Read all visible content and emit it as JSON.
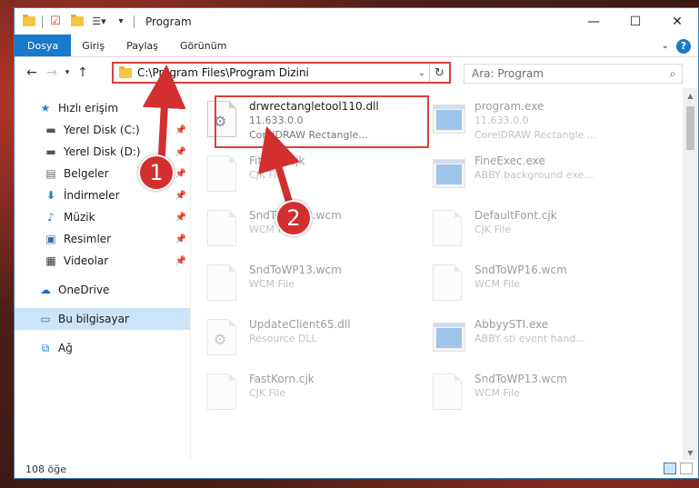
{
  "window": {
    "title": "Program"
  },
  "ribbon": {
    "tabs": [
      "Dosya",
      "Giriş",
      "Paylaş",
      "Görünüm"
    ]
  },
  "address": {
    "path": "C:\\Program Files\\Program Dizini"
  },
  "search": {
    "placeholder": "Ara: Program"
  },
  "nav": {
    "items": [
      {
        "label": "Hızlı erişim",
        "icon": "star-icon"
      },
      {
        "label": "Yerel Disk (C:)",
        "icon": "drive-icon"
      },
      {
        "label": "Yerel Disk (D:)",
        "icon": "drive-icon"
      },
      {
        "label": "Belgeler",
        "icon": "document-icon"
      },
      {
        "label": "İndirmeler",
        "icon": "download-icon"
      },
      {
        "label": "Müzik",
        "icon": "music-icon"
      },
      {
        "label": "Resimler",
        "icon": "pictures-icon"
      },
      {
        "label": "Videolar",
        "icon": "video-icon"
      },
      {
        "label": "OneDrive",
        "icon": "cloud-icon"
      },
      {
        "label": "Bu bilgisayar",
        "icon": "computer-icon"
      },
      {
        "label": "Ağ",
        "icon": "network-icon"
      }
    ]
  },
  "files": [
    {
      "name": "drwrectangletool110.dll",
      "line2": "11.633.0.0",
      "line3": "CorelDRAW Rectangle...",
      "icon": "dll-icon"
    },
    {
      "name": "program.exe",
      "line2": "11.633.0.0",
      "line3": "CorelDRAW Rectangle ...",
      "icon": "exe-icon"
    },
    {
      "name": "Fitman.cjk",
      "line2": "CJK File",
      "line3": "",
      "icon": "file-icon"
    },
    {
      "name": "FineExec.exe",
      "line2": "ABBY background exe...",
      "line3": "",
      "icon": "exe-icon"
    },
    {
      "name": "SndToWP13.wcm",
      "line2": "WCM File",
      "line3": "",
      "icon": "file-icon"
    },
    {
      "name": "DefaultFont.cjk",
      "line2": "CJK File",
      "line3": "",
      "icon": "file-icon"
    },
    {
      "name": "SndToWP13.wcm",
      "line2": "WCM File",
      "line3": "",
      "icon": "file-icon"
    },
    {
      "name": "SndToWP16.wcm",
      "line2": "WCM File",
      "line3": "",
      "icon": "file-icon"
    },
    {
      "name": "UpdateClient65.dll",
      "line2": "Resource DLL",
      "line3": "",
      "icon": "dll-icon"
    },
    {
      "name": "AbbyySTI.exe",
      "line2": "ABBY sti event hand...",
      "line3": "",
      "icon": "exe-icon"
    },
    {
      "name": "FastKorn.cjk",
      "line2": "CJK File",
      "line3": "",
      "icon": "file-icon"
    },
    {
      "name": "SndToWP13.wcm",
      "line2": "WCM File",
      "line3": "",
      "icon": "file-icon"
    }
  ],
  "status": {
    "count": "108 öğe"
  },
  "annotations": {
    "step1": "1",
    "step2": "2"
  },
  "colors": {
    "accent": "#1979ca",
    "highlight": "#d9403a",
    "badge": "#d32f2f"
  }
}
